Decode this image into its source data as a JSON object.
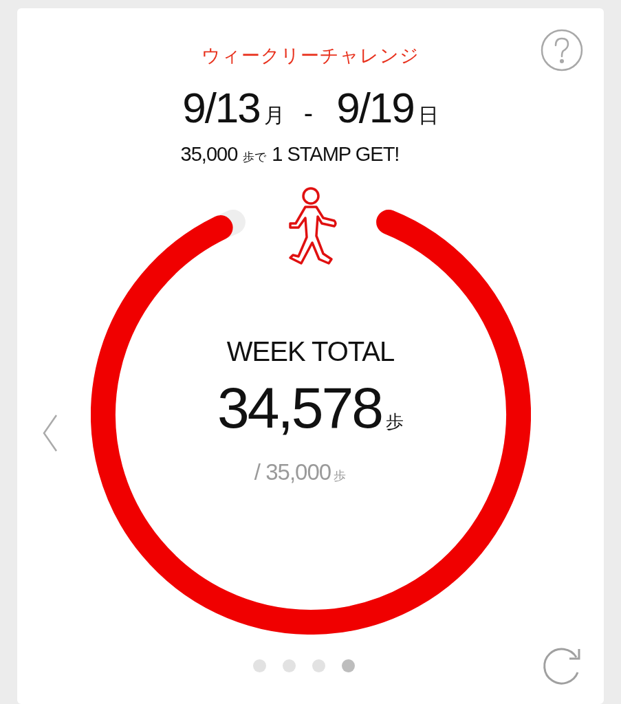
{
  "title": "ウィークリーチャレンジ",
  "period": {
    "start_date": "9/13",
    "start_day": "月",
    "separator": "-",
    "end_date": "9/19",
    "end_day": "日"
  },
  "goal_line": {
    "steps": "35,000",
    "unit": "歩で",
    "reward": "1 STAMP GET!"
  },
  "progress": {
    "label": "WEEK TOTAL",
    "total": "34,578",
    "total_unit": "歩",
    "goal": "/ 35,000",
    "goal_unit": "歩"
  },
  "pager": [
    {
      "selected": false
    },
    {
      "selected": false
    },
    {
      "selected": false
    },
    {
      "selected": true
    }
  ]
}
